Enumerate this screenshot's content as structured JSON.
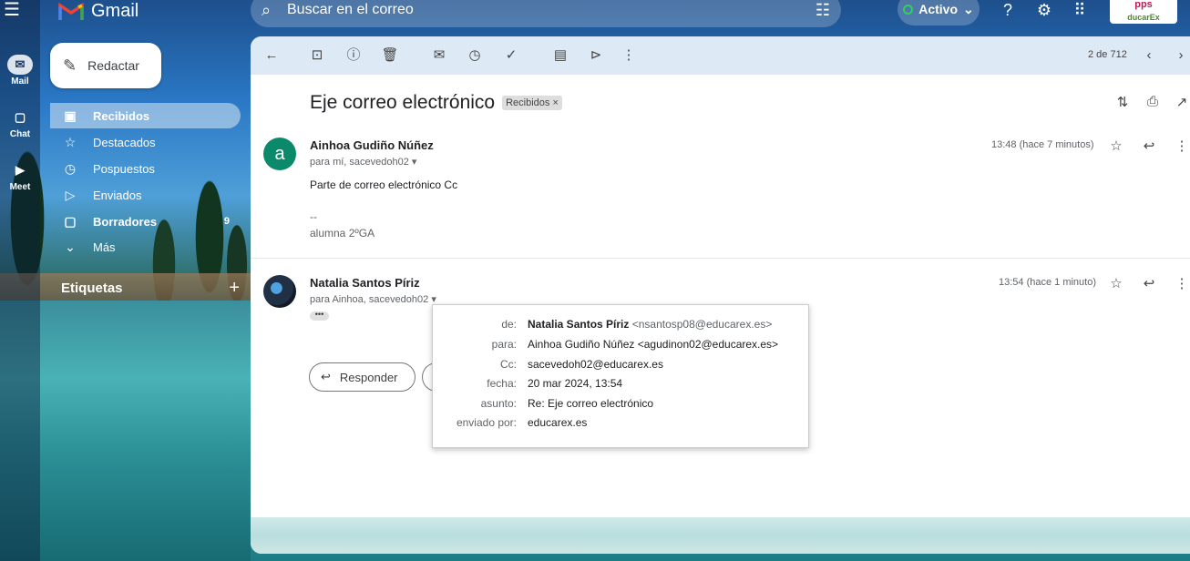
{
  "app": {
    "name": "Gmail",
    "accent": "#1a73e8"
  },
  "rail": [
    {
      "label": "Mail",
      "icon": "mail-icon",
      "glyph": "✉"
    },
    {
      "label": "Chat",
      "icon": "chat-icon",
      "glyph": "☐"
    },
    {
      "label": "Meet",
      "icon": "video-icon",
      "glyph": "▶"
    }
  ],
  "search": {
    "placeholder": "Buscar en el correo"
  },
  "status": {
    "label": "Activo"
  },
  "apps_badge": {
    "line1": "pps",
    "line2": "ducarEx"
  },
  "compose": {
    "label": "Redactar"
  },
  "nav": [
    {
      "label": "Recibidos",
      "icon": "inbox-icon",
      "glyph": "▣",
      "count": ""
    },
    {
      "label": "Destacados",
      "icon": "star-icon",
      "glyph": "☆",
      "count": ""
    },
    {
      "label": "Pospuestos",
      "icon": "clock-icon",
      "glyph": "◷",
      "count": ""
    },
    {
      "label": "Enviados",
      "icon": "send-icon",
      "glyph": "▷",
      "count": ""
    },
    {
      "label": "Borradores",
      "icon": "draft-icon",
      "glyph": "▢",
      "count": "9"
    },
    {
      "label": "Más",
      "icon": "chevron-down-icon",
      "glyph": "⌄",
      "count": ""
    }
  ],
  "labels": {
    "title": "Etiquetas",
    "add": "+"
  },
  "thread": {
    "pager": "2 de 712",
    "subject": "Eje correo electrónico",
    "label_chip": "Recibidos ×"
  },
  "messages": [
    {
      "avatar_letter": "a",
      "sender": "Ainhoa Gudiño Núñez",
      "recipients": "para mí, sacevedoh02",
      "time": "13:48 (hace 7 minutos)",
      "body": "Parte de correo electrónico Cc",
      "sig_sep": "--",
      "signature": "alumna 2ºGA"
    },
    {
      "avatar_letter": "",
      "sender": "Natalia Santos Píriz",
      "recipients": "para Ainhoa, sacevedoh02",
      "time": "13:54 (hace 1 minuto)",
      "dots": "•••"
    }
  ],
  "reply": {
    "label": "Responder"
  },
  "details": {
    "rows": [
      {
        "key": "de:",
        "name": "Natalia Santos Píriz",
        "value": "<nsantosp08@educarex.es>"
      },
      {
        "key": "para:",
        "name": "",
        "value": "Ainhoa Gudiño Núñez <agudinon02@educarex.es>"
      },
      {
        "key": "Cc:",
        "name": "",
        "value": "sacevedoh02@educarex.es"
      },
      {
        "key": "fecha:",
        "name": "",
        "value": "20 mar 2024, 13:54"
      },
      {
        "key": "asunto:",
        "name": "",
        "value": "Re: Eje correo electrónico"
      },
      {
        "key": "enviado por:",
        "name": "",
        "value": "educarex.es"
      }
    ]
  }
}
